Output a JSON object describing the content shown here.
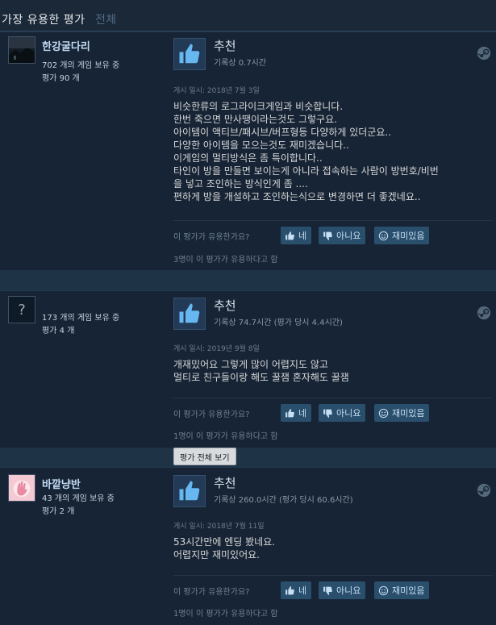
{
  "tabs": {
    "active": "가장 유용한 평가",
    "all": "전체"
  },
  "vote_labels": {
    "question": "이 평가가 유용한가요?",
    "yes": "네",
    "no": "아니요",
    "funny": "재미있음"
  },
  "see_all_label": "평가 전체 보기",
  "reviews": [
    {
      "author": {
        "name": "한강굴다리",
        "games_owned": "702 개의 게임 보유 중",
        "review_count": "평가 90 개",
        "avatar_icon": "dark-landscape-avatar"
      },
      "verdict": "추천",
      "hours": "기록상 0.7시간",
      "posted": "게시 일시: 2018년 7월 3일",
      "body": [
        "비슷한류의 로그라이크게임과 비슷합니다.",
        "한번 죽으면 만사땡이라는것도 그렇구요.",
        "아이템이 액티브/패시브/버프형등 다양하게 있더군요..",
        "다양한 아이템을 모으는것도 재미겠습니다..",
        "이게임의 멀티방식은 좀 특이합니다..",
        "타인이 방을 만들면 보이는게 아니라 접속하는 사람이 방번호/비번",
        "을 넣고 조인하는 방식인게 좀 ....",
        "편하게 방을 개설하고 조인하는식으로 변경하면 더 좋겠네요.."
      ],
      "helpful": "3명이 이 평가가 유용하다고 함"
    },
    {
      "author": {
        "name": "",
        "games_owned": "173 개의 게임 보유 중",
        "review_count": "평가 4 개",
        "avatar_icon": "question-mark-avatar",
        "avatar_glyph": "?"
      },
      "verdict": "추천",
      "hours": "기록상 74.7시간 (평가 당시 4.4시간)",
      "posted": "게시 일시: 2019년 9월 8일",
      "body": [
        "개재밌어요 그렇게 많이 어렵지도 않고",
        "멀티로 친구들이랑 해도 꿀잼 혼자해도 꿀잼"
      ],
      "helpful": "1명이 이 평가가 유용하다고 함"
    },
    {
      "author": {
        "name": "바깥냥반",
        "games_owned": "43 개의 게임 보유 중",
        "review_count": "평가 2 개",
        "avatar_icon": "pink-hand-avatar"
      },
      "verdict": "추천",
      "hours": "기록상 260.0시간 (평가 당시 60.6시간)",
      "posted": "게시 일시: 2018년 7월 11일",
      "body": [
        "53시간만에 엔딩 봤네요.",
        "어렵지만 재미있어요."
      ],
      "helpful": "1명이 이 평가가 유용하다고 함"
    }
  ]
}
